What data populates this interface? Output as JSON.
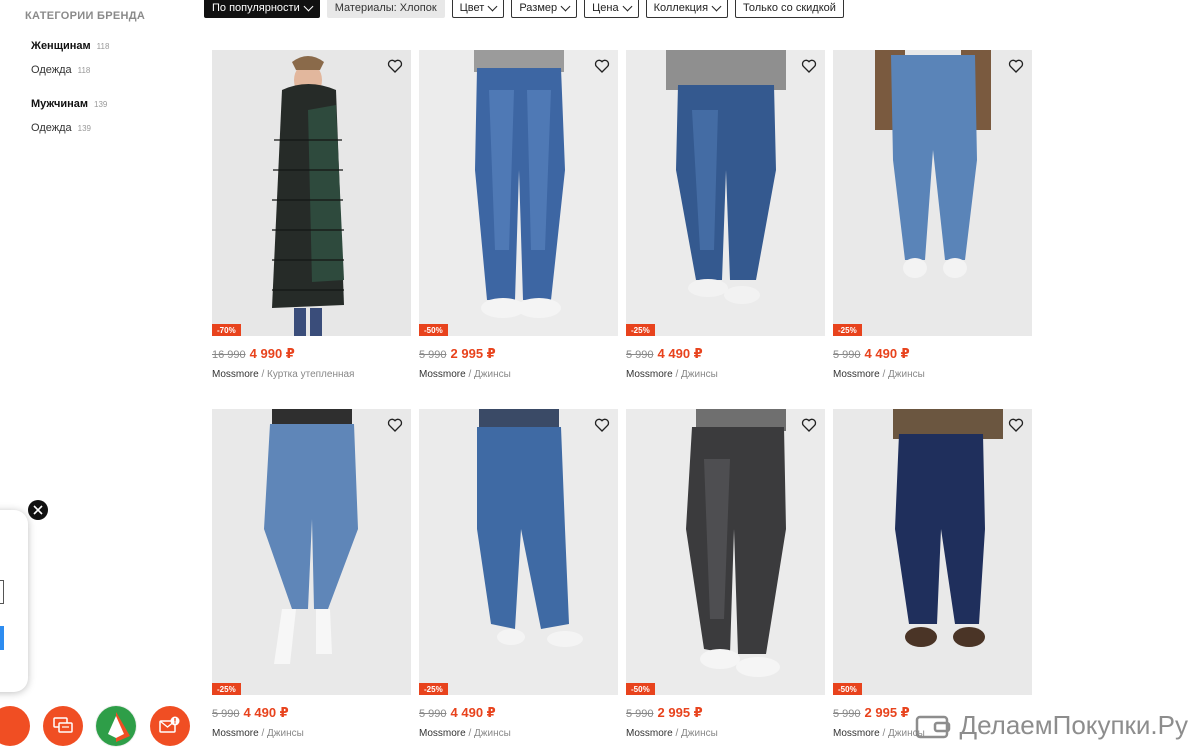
{
  "sidebar": {
    "title": "КАТЕГОРИИ БРЕНДА",
    "groups": [
      {
        "label": "Женщинам",
        "count": "118",
        "sub_label": "Одежда",
        "sub_count": "118"
      },
      {
        "label": "Мужчинам",
        "count": "139",
        "sub_label": "Одежда",
        "sub_count": "139"
      }
    ]
  },
  "filters": {
    "sort": "По популярности",
    "material": "Материалы: Хлопок",
    "color": "Цвет",
    "size": "Размер",
    "price": "Цена",
    "collection": "Коллекция",
    "discount": "Только со скидкой"
  },
  "products": [
    {
      "discount": "-70%",
      "old_price": "16 990",
      "price": "4 990 ₽",
      "brand": "Mossmore",
      "type": "Куртка утепленная"
    },
    {
      "discount": "-50%",
      "old_price": "5 990",
      "price": "2 995 ₽",
      "brand": "Mossmore",
      "type": "Джинсы"
    },
    {
      "discount": "-25%",
      "old_price": "5 990",
      "price": "4 490 ₽",
      "brand": "Mossmore",
      "type": "Джинсы"
    },
    {
      "discount": "-25%",
      "old_price": "5 990",
      "price": "4 490 ₽",
      "brand": "Mossmore",
      "type": "Джинсы"
    },
    {
      "discount": "-25%",
      "old_price": "5 990",
      "price": "4 490 ₽",
      "brand": "Mossmore",
      "type": "Джинсы"
    },
    {
      "discount": "-25%",
      "old_price": "5 990",
      "price": "4 490 ₽",
      "brand": "Mossmore",
      "type": "Джинсы"
    },
    {
      "discount": "-50%",
      "old_price": "5 990",
      "price": "2 995 ₽",
      "brand": "Mossmore",
      "type": "Джинсы"
    },
    {
      "discount": "-50%",
      "old_price": "5 990",
      "price": "2 995 ₽",
      "brand": "Mossmore",
      "type": "Джинсы"
    }
  ],
  "separator": "/",
  "colors": {
    "accent": "#e8431d",
    "chat_blue": "#2d8cf0"
  },
  "icons": [
    "heart-icon",
    "close-icon",
    "chat-icon",
    "message-alert-icon",
    "chevron-down-icon"
  ],
  "watermark": "ДелаемПокупки.Ру"
}
